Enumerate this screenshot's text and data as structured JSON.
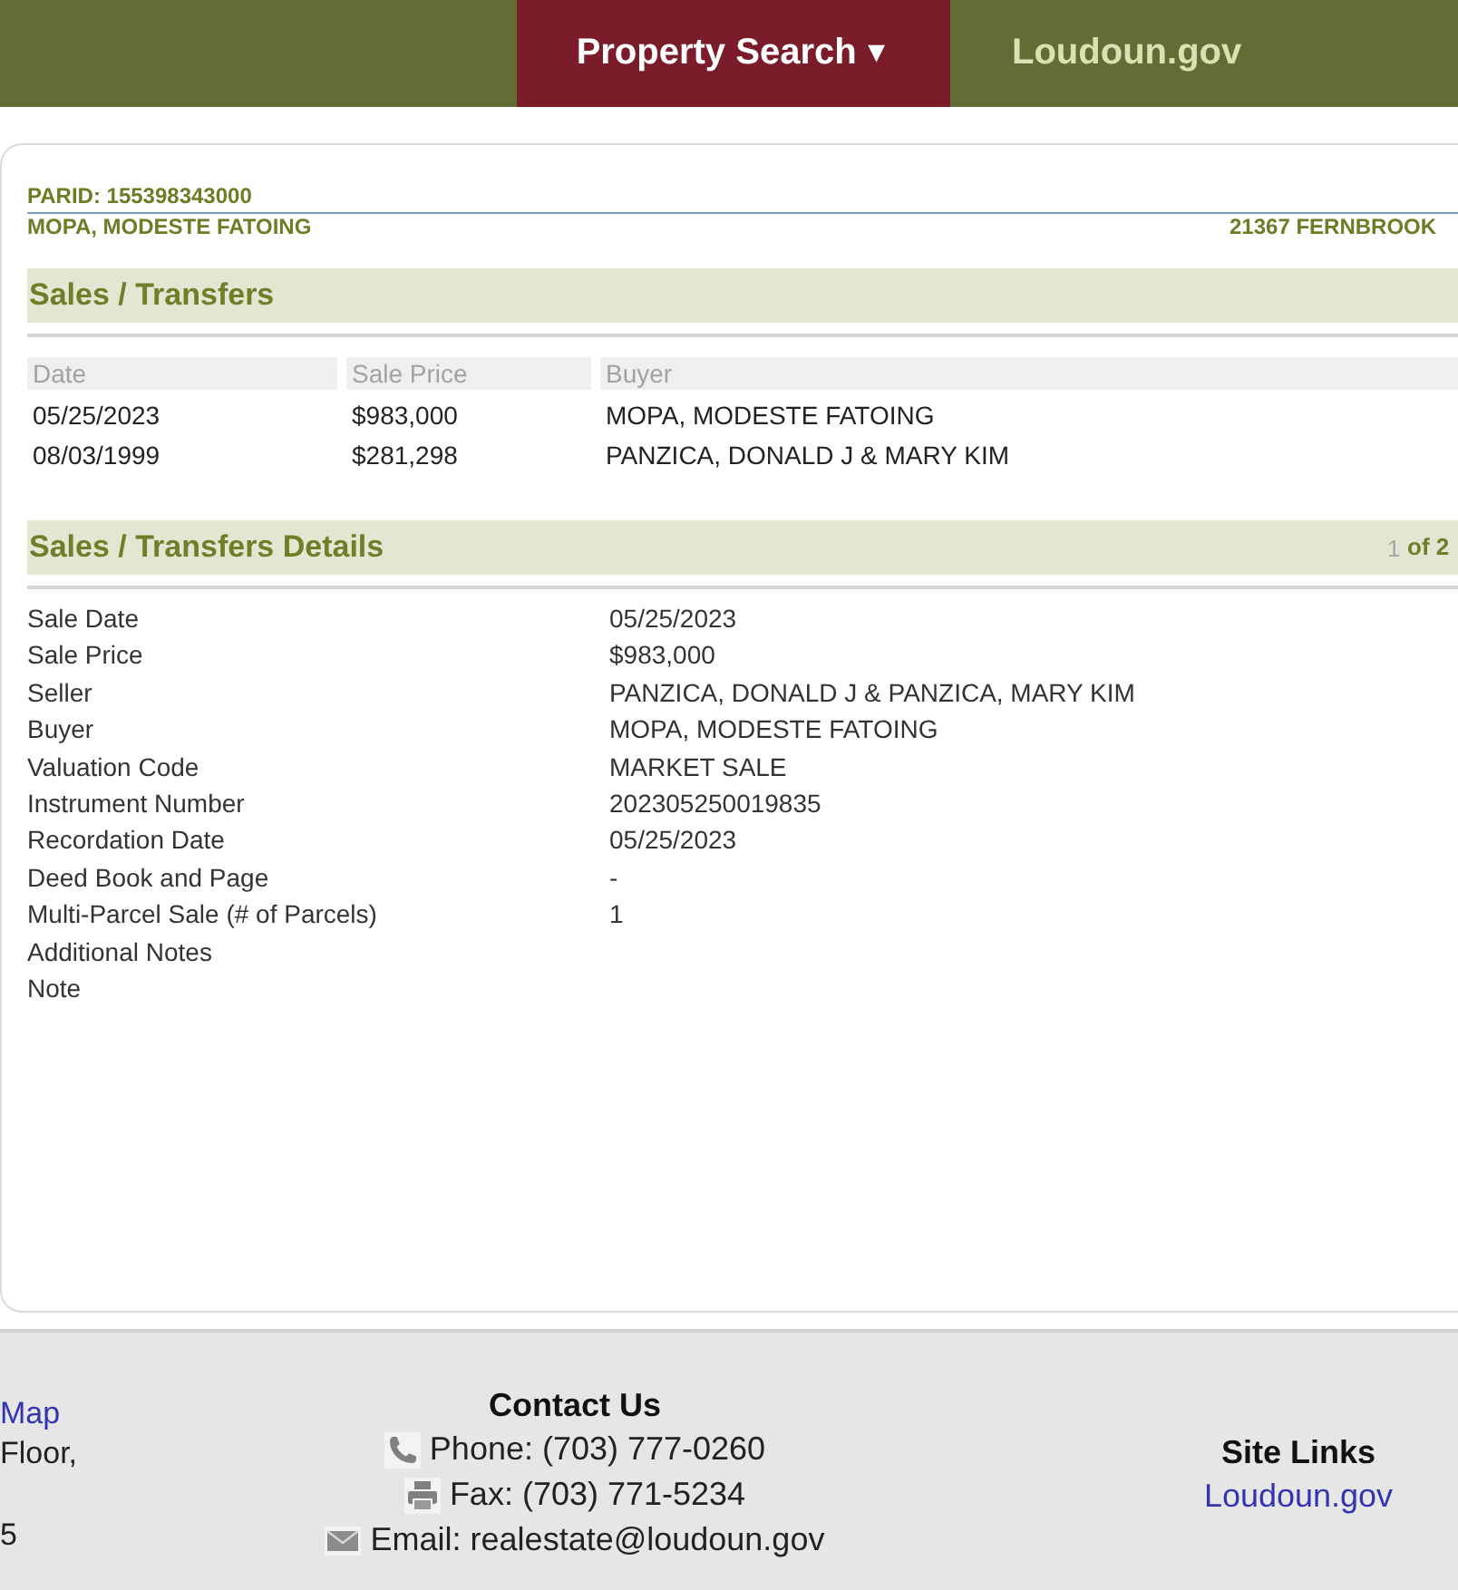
{
  "nav": {
    "items": [
      {
        "label": "Property Search",
        "caret": "▼",
        "selected": true
      },
      {
        "label": "Loudoun.gov",
        "selected": false
      }
    ]
  },
  "parcel": {
    "parid": "PARID: 155398343000",
    "owner": "MOPA, MODESTE FATOING",
    "address": "21367 FERNBROOK"
  },
  "sales_transfers": {
    "title": "Sales / Transfers",
    "columns": [
      "Date",
      "Sale Price",
      "Buyer"
    ],
    "rows": [
      [
        "05/25/2023",
        "$983,000",
        "MOPA, MODESTE FATOING"
      ],
      [
        "08/03/1999",
        "$281,298",
        "PANZICA, DONALD J & MARY KIM"
      ]
    ]
  },
  "sales_transfers_details": {
    "title": "Sales / Transfers Details",
    "pager": {
      "page": "1",
      "total": "of 2"
    },
    "fields": [
      {
        "label": "Sale Date",
        "value": "05/25/2023"
      },
      {
        "label": "Sale Price",
        "value": "$983,000"
      },
      {
        "label": "Seller",
        "value": "PANZICA, DONALD J & PANZICA, MARY KIM"
      },
      {
        "label": "Buyer",
        "value": "MOPA, MODESTE FATOING"
      },
      {
        "label": "Valuation Code",
        "value": "MARKET SALE"
      },
      {
        "label": "Instrument Number",
        "value": "202305250019835"
      },
      {
        "label": "Recordation Date",
        "value": "05/25/2023"
      },
      {
        "label": "Deed Book and Page",
        "value": "-"
      },
      {
        "label": "Multi-Parcel Sale (# of Parcels)",
        "value": "1"
      },
      {
        "label": "Additional Notes"
      },
      {
        "label": "Note"
      }
    ]
  },
  "footer": {
    "column_1": [
      {
        "kind": "link",
        "text": "Map"
      },
      {
        "kind": "text",
        "text": "Floor,"
      },
      {
        "kind": "text",
        "text": "5"
      }
    ],
    "contact": {
      "title": "Contact Us",
      "items": [
        {
          "kind": "phone",
          "text": "Phone: (703) 777-0260"
        },
        {
          "kind": "fax",
          "text": "Fax: (703) 771-5234"
        },
        {
          "kind": "email",
          "text": "Email: realestate@loudoun.gov"
        }
      ]
    },
    "site_links": {
      "title": "Site Links",
      "links": [
        "Loudoun.gov"
      ]
    }
  }
}
